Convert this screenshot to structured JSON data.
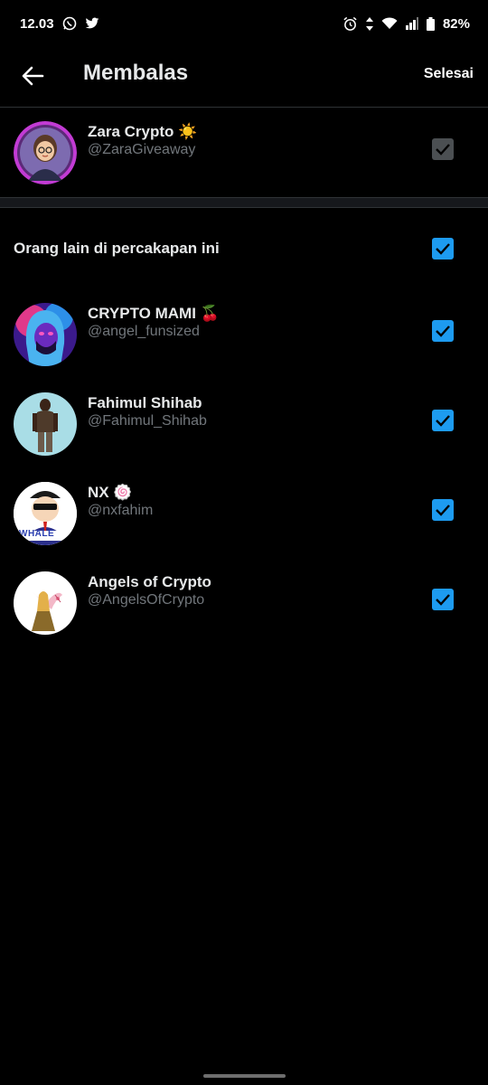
{
  "status_bar": {
    "time": "12.03",
    "battery": "82%",
    "icons_left": [
      "whatsapp-icon",
      "twitter-icon"
    ],
    "icons_right": [
      "alarm-icon",
      "data-arrows-icon",
      "wifi-icon",
      "signal-icon",
      "battery-icon"
    ]
  },
  "header": {
    "title": "Membalas",
    "done_label": "Selesai",
    "back_icon": "arrow-left-icon"
  },
  "primary_user": {
    "name": "Zara Crypto ☀️",
    "handle": "@ZaraGiveaway",
    "checked": true,
    "checkbox_state": "disabled"
  },
  "section": {
    "label": "Orang lain di percakapan ini",
    "checked": true
  },
  "users": [
    {
      "name": "CRYPTO MAMI 🍒",
      "handle": "@angel_funsized",
      "checked": true
    },
    {
      "name": "Fahimul Shihab",
      "handle": "@Fahimul_Shihab",
      "checked": true
    },
    {
      "name": "NX 🍥",
      "handle": "@nxfahim",
      "checked": true
    },
    {
      "name": "Angels of Crypto",
      "handle": "@AngelsOfCrypto",
      "checked": true
    }
  ],
  "avatar_badges": {
    "nx_banner": "WHALE"
  },
  "colors": {
    "background": "#000000",
    "accent": "#1d9bf0",
    "text_primary": "#e7e9ea",
    "text_secondary": "#71767b",
    "disabled_checkbox": "#4b4f52"
  }
}
